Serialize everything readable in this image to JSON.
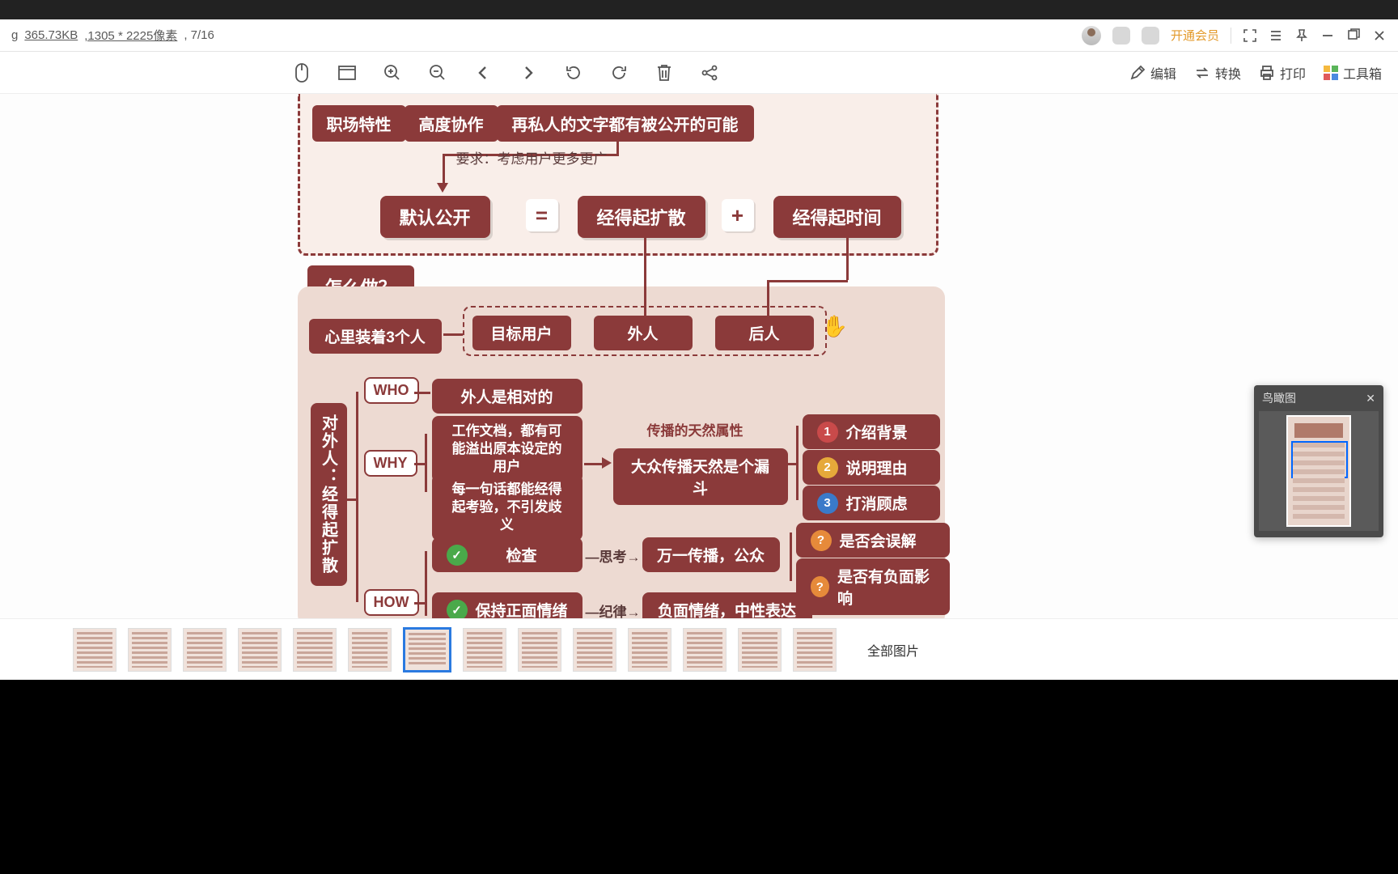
{
  "infobar": {
    "ext": "g",
    "size": "365.73KB",
    "dims": ",1305 * 2225像素",
    "page": ", 7/16",
    "vip": "开通会员"
  },
  "toolbar": {
    "edit": "编辑",
    "convert": "转换",
    "print": "打印",
    "toolbox": "工具箱"
  },
  "diagram": {
    "workplace": "职场特性",
    "collab": "高度协作",
    "privacy": "再私人的文字都有被公开的可能",
    "req": "要求：考虑用户更多更广",
    "default_open": "默认公开",
    "eq": "=",
    "spread": "经得起扩散",
    "plus": "+",
    "time": "经得起时间",
    "how_title": "怎么做？",
    "three_people": "心里装着3个人",
    "target_user": "目标用户",
    "outsider": "外人",
    "later": "后人",
    "vert1": "对外人：经得起扩散",
    "who": "WHO",
    "who_desc": "外人是相对的",
    "why": "WHY",
    "why_desc1": "工作文档，都有可能溢出原本设定的用户",
    "why_desc2": "每一句话都能经得起考验，不引发歧义",
    "nature": "传播的天然属性",
    "funnel": "大众传播天然是个漏斗",
    "item1": "介绍背景",
    "item2": "说明理由",
    "item3": "打消顾虑",
    "how": "HOW",
    "check": "检查",
    "think": "思考",
    "spread_public": "万一传播，公众",
    "q1": "是否会误解",
    "q2": "是否有负面影响",
    "positive": "保持正面情绪",
    "discipline": "纪律",
    "negative": "负面情绪，中性表达"
  },
  "birdseye": {
    "title": "鸟瞰图"
  },
  "thumbs": {
    "all": "全部图片"
  }
}
